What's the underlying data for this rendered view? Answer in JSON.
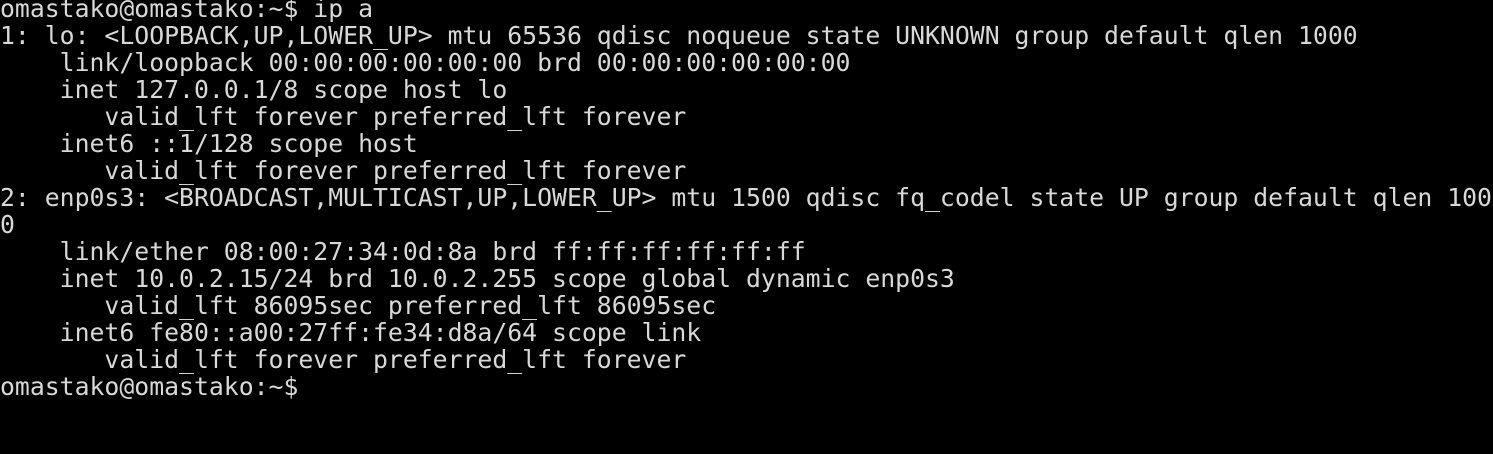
{
  "terminal": {
    "lines": [
      "omastako@omastako:~$ ip a",
      "1: lo: <LOOPBACK,UP,LOWER_UP> mtu 65536 qdisc noqueue state UNKNOWN group default qlen 1000",
      "    link/loopback 00:00:00:00:00:00 brd 00:00:00:00:00:00",
      "    inet 127.0.0.1/8 scope host lo",
      "       valid_lft forever preferred_lft forever",
      "    inet6 ::1/128 scope host",
      "       valid_lft forever preferred_lft forever",
      "2: enp0s3: <BROADCAST,MULTICAST,UP,LOWER_UP> mtu 1500 qdisc fq_codel state UP group default qlen 100",
      "0",
      "    link/ether 08:00:27:34:0d:8a brd ff:ff:ff:ff:ff:ff",
      "    inet 10.0.2.15/24 brd 10.0.2.255 scope global dynamic enp0s3",
      "       valid_lft 86095sec preferred_lft 86095sec",
      "    inet6 fe80::a00:27ff:fe34:d8a/64 scope link",
      "       valid_lft forever preferred_lft forever",
      "omastako@omastako:~$"
    ]
  },
  "colors": {
    "background": "#000000",
    "foreground": "#d8d8d8"
  }
}
